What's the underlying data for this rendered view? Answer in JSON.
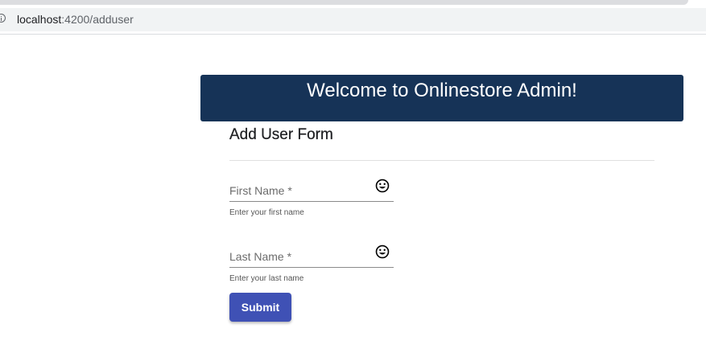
{
  "browser": {
    "url_host": "localhost",
    "url_path": ":4200/adduser"
  },
  "banner": {
    "title": "Welcome to Onlinestore Admin!"
  },
  "form": {
    "title": "Add User Form",
    "fields": [
      {
        "label": "First Name *",
        "hint": "Enter your first name",
        "value": "",
        "icon": "smiley-face-icon"
      },
      {
        "label": "Last Name *",
        "hint": "Enter your last name",
        "value": "",
        "icon": "smiley-face-icon"
      }
    ],
    "submit_label": "Submit"
  },
  "colors": {
    "banner_bg": "#163357",
    "button_bg": "#3f51b5"
  }
}
